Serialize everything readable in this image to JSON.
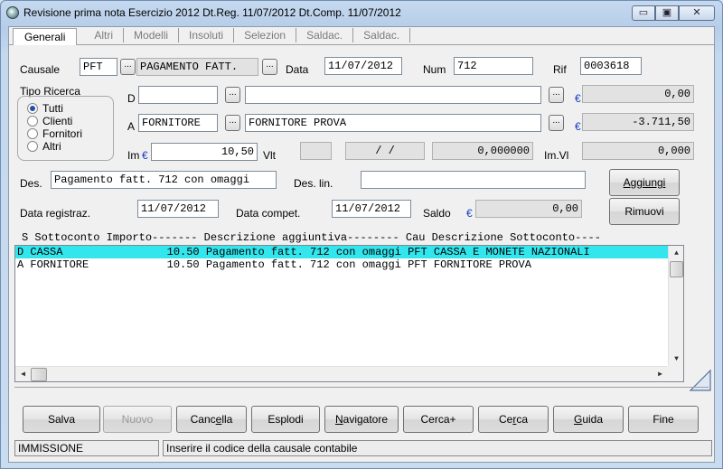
{
  "window": {
    "title": "Revisione prima nota  Esercizio 2012  Dt.Reg. 11/07/2012  Dt.Comp. 11/07/2012",
    "min": "▭",
    "max": "▣",
    "close": "✕"
  },
  "tabs": [
    "Generali",
    "Altri",
    "Modelli",
    "Insoluti",
    "Selezion",
    "Saldac.",
    "Saldac."
  ],
  "form": {
    "causale_label": "Causale",
    "causale_code": "PFT",
    "causale_desc": "PAGAMENTO FATT.",
    "data_label": "Data",
    "data_value": "11/07/2012",
    "num_label": "Num",
    "num_value": "712",
    "rif_label": "Rif",
    "rif_value": "0003618",
    "tipo_ricerca_label": "Tipo Ricerca",
    "radio_options": [
      "Tutti",
      "Clienti",
      "Fornitori",
      "Altri"
    ],
    "radio_selected": "Tutti",
    "d_label": "D",
    "d_code": "",
    "d_desc": "",
    "d_amount": "0,00",
    "a_label": "A",
    "a_code": "FORNITORE",
    "a_desc": "FORNITORE PROVA",
    "a_amount": "-3.711,50",
    "im_label": "Im",
    "im_value": "10,50",
    "vlt_label": "Vlt",
    "vlt_value": "",
    "date_blank": "/  /",
    "cambio_value": "0,000000",
    "imvl_label": "Im.Vl",
    "imvl_value": "0,000",
    "des_label": "Des.",
    "des_value": "Pagamento fatt. 712 con omaggi",
    "deslin_label": "Des. lin.",
    "deslin_value": "",
    "datareg_label": "Data registraz.",
    "datareg_value": "11/07/2012",
    "datacomp_label": "Data compet.",
    "datacomp_value": "11/07/2012",
    "saldo_label": "Saldo",
    "saldo_value": "0,00",
    "euro": "€",
    "ellipsis": "..."
  },
  "buttons_side": {
    "aggiungi": "Aggiungi",
    "rimuovi": "Rimuovi"
  },
  "list": {
    "header": "S Sottoconto Importo------- Descrizione aggiuntiva-------- Cau Descrizione Sottoconto----",
    "rows": [
      "D CASSA                10.50 Pagamento fatt. 712 con omaggi PFT CASSA E MONETE NAZIONALI",
      "A FORNITORE            10.50 Pagamento fatt. 712 con omaggi PFT FORNITORE PROVA"
    ],
    "selected_index": 0
  },
  "toolbar": [
    "Salva",
    "Nuovo",
    "Cancella",
    "Esplodi",
    "Navigatore",
    "Cerca+",
    "Cerca",
    "Guida",
    "Fine"
  ],
  "status": {
    "mode": "IMMISSIONE",
    "hint": "Inserire il codice della causale contabile"
  }
}
